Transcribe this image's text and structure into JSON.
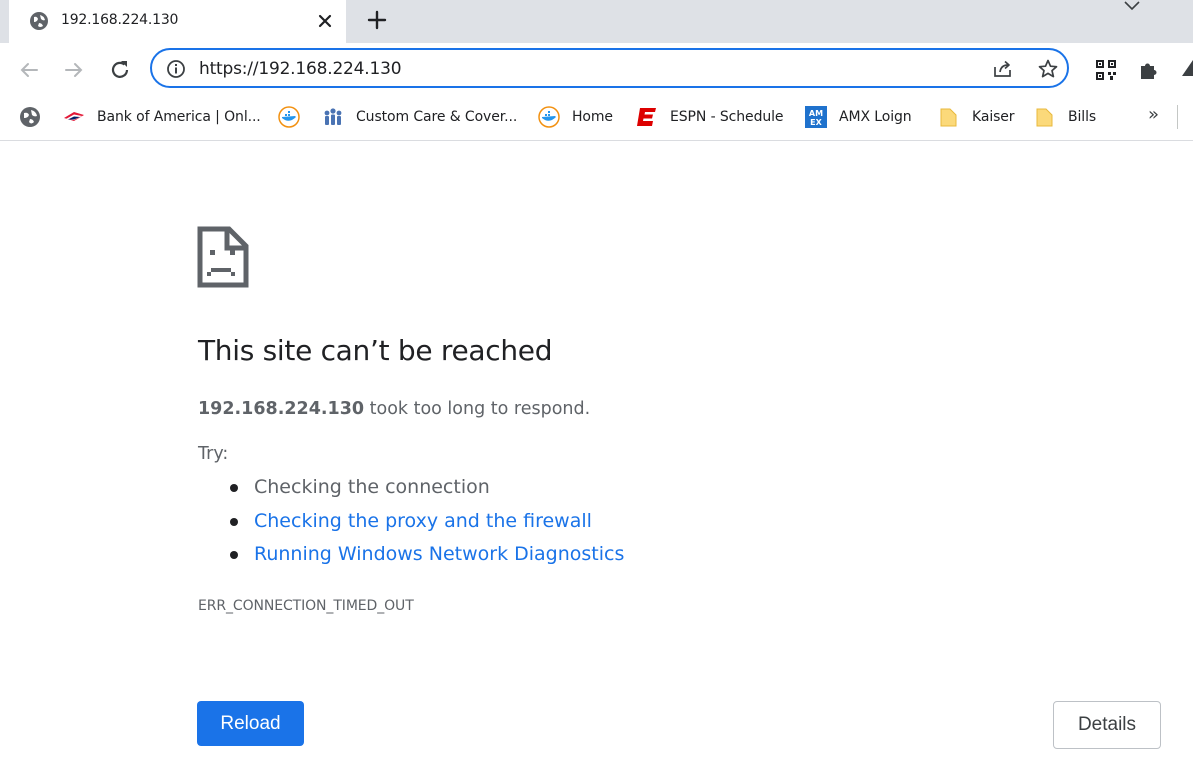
{
  "tab": {
    "title": "192.168.224.130"
  },
  "omnibox": {
    "url": "https://192.168.224.130"
  },
  "bookmarks": {
    "items": [
      {
        "label": "",
        "icon": "globe-icon"
      },
      {
        "label": "Bank of America | Onl...",
        "icon": "bank-of-america-flag-icon"
      },
      {
        "label": "",
        "icon": "docker-whale-icon"
      },
      {
        "label": "Custom Care & Cover...",
        "icon": "people-group-icon"
      },
      {
        "label": "Home",
        "icon": "docker-whale-icon"
      },
      {
        "label": "ESPN - Schedule",
        "icon": "espn-logo-icon"
      },
      {
        "label": "AMX Loign",
        "icon": "amex-logo-icon"
      },
      {
        "label": "Kaiser",
        "icon": "folder-icon"
      },
      {
        "label": "Bills",
        "icon": "folder-icon"
      }
    ],
    "more_label": "»"
  },
  "error": {
    "heading": "This site can’t be reached",
    "host": "192.168.224.130",
    "summary_rest": " took too long to respond.",
    "try_label": "Try:",
    "suggestions": [
      {
        "text": "Checking the connection",
        "link": false
      },
      {
        "text": "Checking the proxy and the firewall",
        "link": true
      },
      {
        "text": "Running Windows Network Diagnostics",
        "link": true
      }
    ],
    "code": "ERR_CONNECTION_TIMED_OUT"
  },
  "buttons": {
    "reload": "Reload",
    "details": "Details"
  },
  "colors": {
    "accent": "#1a73e8",
    "text_primary": "#202124",
    "text_secondary": "#5f6368",
    "tabstrip_bg": "#dee1e6"
  }
}
